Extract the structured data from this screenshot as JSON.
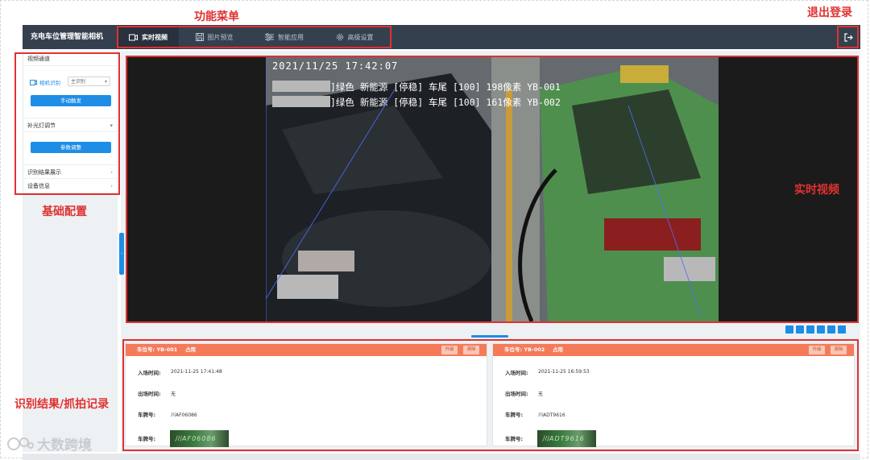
{
  "app": {
    "title": "充电车位管理智能相机"
  },
  "nav": {
    "tabs": [
      {
        "label": "实时视频",
        "icon": "video-camera-icon",
        "active": true
      },
      {
        "label": "图片预览",
        "icon": "image-save-icon",
        "active": false
      },
      {
        "label": "智能应用",
        "icon": "sliders-icon",
        "active": false
      },
      {
        "label": "高级设置",
        "icon": "gear-icon",
        "active": false
      }
    ],
    "logout_icon": "logout-icon"
  },
  "sidebar": {
    "video_channel": "视频通道",
    "camera_label": "相机识别",
    "camera_select": "主识别",
    "manual_trigger": "手动触发",
    "fill_light": "补光灯调节",
    "param_adjust": "参数调整",
    "result_display": "识别结果展示",
    "device_info": "设备信息"
  },
  "video": {
    "timestamp": "2021/11/25  17:42:07",
    "overlay_lines": [
      "]绿色 新能源 [停稳] 车尾 [100] 198像素 YB-001",
      "]绿色 新能源 [停稳] 车尾 [100] 161像素 YB-002"
    ]
  },
  "results": {
    "cards": [
      {
        "space_label": "车位号:",
        "space_value": "YB-001",
        "status": "占用",
        "btn_lift": "升级",
        "btn_clear": "清除",
        "entry_label": "入场时间:",
        "entry_value": "2021-11-25 17:41:48",
        "exit_label": "出场时间:",
        "exit_value": "无",
        "plate_label": "车牌号:",
        "plate_value": "川AF06086",
        "plate_img_label": "车牌号:",
        "plate_img_text": "川AF06086"
      },
      {
        "space_label": "车位号:",
        "space_value": "YB-002",
        "status": "占用",
        "btn_lift": "升级",
        "btn_clear": "清除",
        "entry_label": "入场时间:",
        "entry_value": "2021-11-25 16:59:53",
        "exit_label": "出场时间:",
        "exit_value": "无",
        "plate_label": "车牌号:",
        "plate_value": "川ADT9616",
        "plate_img_label": "车牌号:",
        "plate_img_text": "川ADT9616"
      }
    ]
  },
  "annotations": {
    "menu": "功能菜单",
    "logout": "退出登录",
    "basic_config": "基础配置",
    "live_video": "实时视频",
    "results": "识别结果/抓拍记录"
  },
  "watermark": "大数跨境",
  "colors": {
    "accent": "#1d8de6",
    "topbar": "#35404f",
    "card_header": "#f47a5a",
    "annotation": "#e03131"
  }
}
